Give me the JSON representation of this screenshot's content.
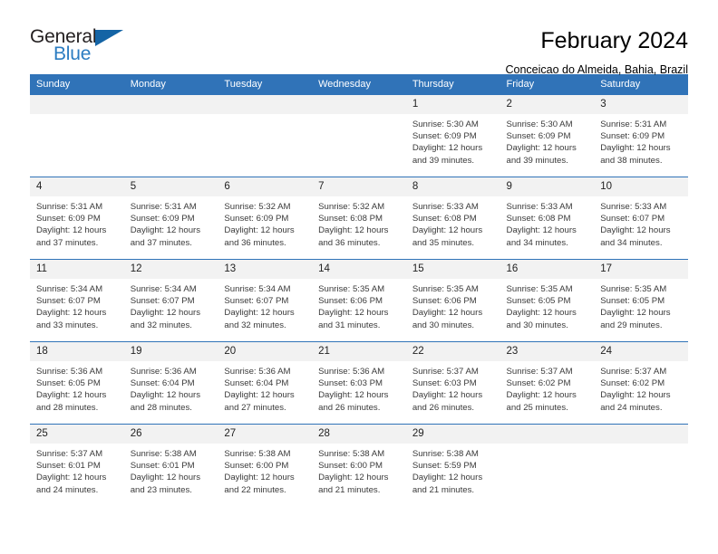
{
  "brand": {
    "name_part1": "General",
    "name_part2": "Blue",
    "triangle_color": "#1464a5",
    "blue_color": "#2b7cc1"
  },
  "header": {
    "month_title": "February 2024",
    "location": "Conceicao do Almeida, Bahia, Brazil",
    "header_bg_color": "#3073b8",
    "row_divider_color": "#3073b8",
    "daynum_bg_color": "#f2f2f2"
  },
  "calendar": {
    "weekday_headers": [
      "Sunday",
      "Monday",
      "Tuesday",
      "Wednesday",
      "Thursday",
      "Friday",
      "Saturday"
    ],
    "weeks": [
      [
        {
          "day": "",
          "details": ""
        },
        {
          "day": "",
          "details": ""
        },
        {
          "day": "",
          "details": ""
        },
        {
          "day": "",
          "details": ""
        },
        {
          "day": "1",
          "details": "Sunrise: 5:30 AM\nSunset: 6:09 PM\nDaylight: 12 hours\nand 39 minutes."
        },
        {
          "day": "2",
          "details": "Sunrise: 5:30 AM\nSunset: 6:09 PM\nDaylight: 12 hours\nand 39 minutes."
        },
        {
          "day": "3",
          "details": "Sunrise: 5:31 AM\nSunset: 6:09 PM\nDaylight: 12 hours\nand 38 minutes."
        }
      ],
      [
        {
          "day": "4",
          "details": "Sunrise: 5:31 AM\nSunset: 6:09 PM\nDaylight: 12 hours\nand 37 minutes."
        },
        {
          "day": "5",
          "details": "Sunrise: 5:31 AM\nSunset: 6:09 PM\nDaylight: 12 hours\nand 37 minutes."
        },
        {
          "day": "6",
          "details": "Sunrise: 5:32 AM\nSunset: 6:09 PM\nDaylight: 12 hours\nand 36 minutes."
        },
        {
          "day": "7",
          "details": "Sunrise: 5:32 AM\nSunset: 6:08 PM\nDaylight: 12 hours\nand 36 minutes."
        },
        {
          "day": "8",
          "details": "Sunrise: 5:33 AM\nSunset: 6:08 PM\nDaylight: 12 hours\nand 35 minutes."
        },
        {
          "day": "9",
          "details": "Sunrise: 5:33 AM\nSunset: 6:08 PM\nDaylight: 12 hours\nand 34 minutes."
        },
        {
          "day": "10",
          "details": "Sunrise: 5:33 AM\nSunset: 6:07 PM\nDaylight: 12 hours\nand 34 minutes."
        }
      ],
      [
        {
          "day": "11",
          "details": "Sunrise: 5:34 AM\nSunset: 6:07 PM\nDaylight: 12 hours\nand 33 minutes."
        },
        {
          "day": "12",
          "details": "Sunrise: 5:34 AM\nSunset: 6:07 PM\nDaylight: 12 hours\nand 32 minutes."
        },
        {
          "day": "13",
          "details": "Sunrise: 5:34 AM\nSunset: 6:07 PM\nDaylight: 12 hours\nand 32 minutes."
        },
        {
          "day": "14",
          "details": "Sunrise: 5:35 AM\nSunset: 6:06 PM\nDaylight: 12 hours\nand 31 minutes."
        },
        {
          "day": "15",
          "details": "Sunrise: 5:35 AM\nSunset: 6:06 PM\nDaylight: 12 hours\nand 30 minutes."
        },
        {
          "day": "16",
          "details": "Sunrise: 5:35 AM\nSunset: 6:05 PM\nDaylight: 12 hours\nand 30 minutes."
        },
        {
          "day": "17",
          "details": "Sunrise: 5:35 AM\nSunset: 6:05 PM\nDaylight: 12 hours\nand 29 minutes."
        }
      ],
      [
        {
          "day": "18",
          "details": "Sunrise: 5:36 AM\nSunset: 6:05 PM\nDaylight: 12 hours\nand 28 minutes."
        },
        {
          "day": "19",
          "details": "Sunrise: 5:36 AM\nSunset: 6:04 PM\nDaylight: 12 hours\nand 28 minutes."
        },
        {
          "day": "20",
          "details": "Sunrise: 5:36 AM\nSunset: 6:04 PM\nDaylight: 12 hours\nand 27 minutes."
        },
        {
          "day": "21",
          "details": "Sunrise: 5:36 AM\nSunset: 6:03 PM\nDaylight: 12 hours\nand 26 minutes."
        },
        {
          "day": "22",
          "details": "Sunrise: 5:37 AM\nSunset: 6:03 PM\nDaylight: 12 hours\nand 26 minutes."
        },
        {
          "day": "23",
          "details": "Sunrise: 5:37 AM\nSunset: 6:02 PM\nDaylight: 12 hours\nand 25 minutes."
        },
        {
          "day": "24",
          "details": "Sunrise: 5:37 AM\nSunset: 6:02 PM\nDaylight: 12 hours\nand 24 minutes."
        }
      ],
      [
        {
          "day": "25",
          "details": "Sunrise: 5:37 AM\nSunset: 6:01 PM\nDaylight: 12 hours\nand 24 minutes."
        },
        {
          "day": "26",
          "details": "Sunrise: 5:38 AM\nSunset: 6:01 PM\nDaylight: 12 hours\nand 23 minutes."
        },
        {
          "day": "27",
          "details": "Sunrise: 5:38 AM\nSunset: 6:00 PM\nDaylight: 12 hours\nand 22 minutes."
        },
        {
          "day": "28",
          "details": "Sunrise: 5:38 AM\nSunset: 6:00 PM\nDaylight: 12 hours\nand 21 minutes."
        },
        {
          "day": "29",
          "details": "Sunrise: 5:38 AM\nSunset: 5:59 PM\nDaylight: 12 hours\nand 21 minutes."
        },
        {
          "day": "",
          "details": ""
        },
        {
          "day": "",
          "details": ""
        }
      ]
    ]
  }
}
